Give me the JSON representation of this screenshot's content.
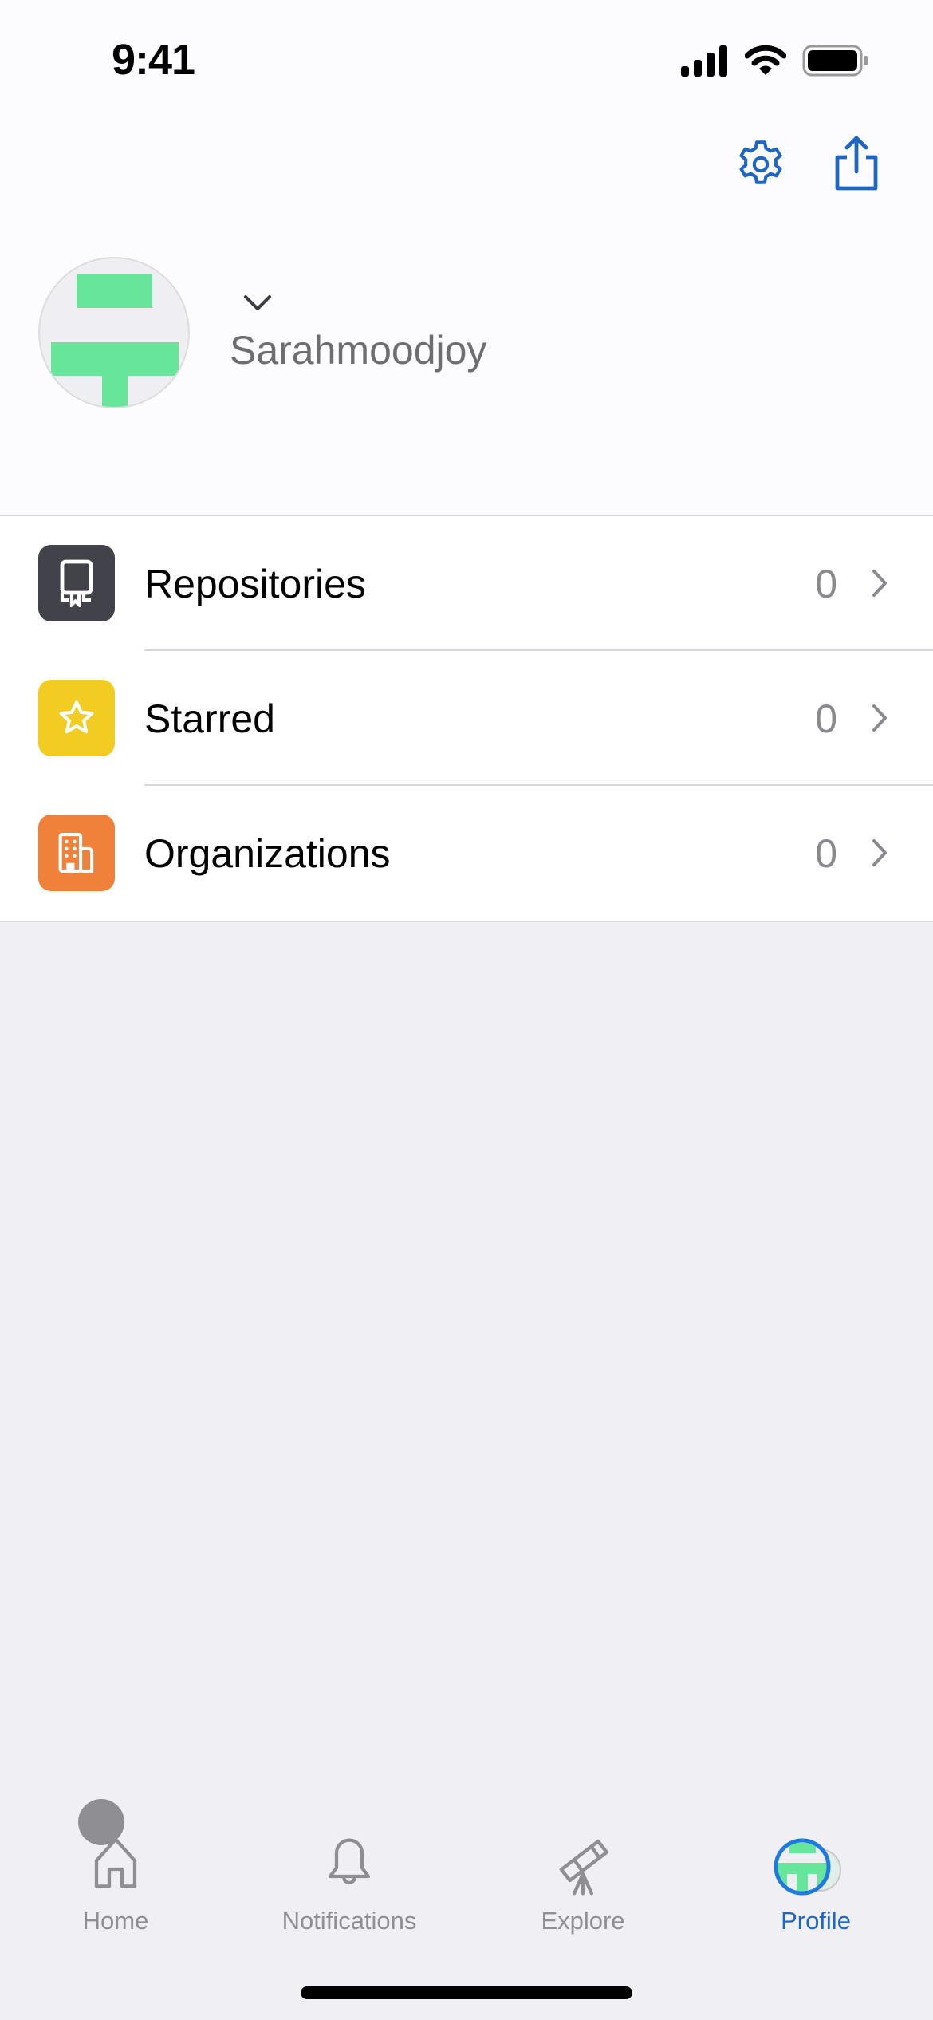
{
  "status_bar": {
    "time": "9:41",
    "icons": [
      "cellular-signal-icon",
      "wifi-icon",
      "battery-icon"
    ]
  },
  "toolbar": {
    "settings_icon": "gear-icon",
    "share_icon": "share-icon"
  },
  "profile": {
    "username": "Sarahmoodjoy",
    "account_switcher_icon": "chevron-down-icon",
    "avatar_color": "#67e59b"
  },
  "menu": {
    "items": [
      {
        "label": "Repositories",
        "count": "0",
        "icon": "repo-icon",
        "color": "#42424a"
      },
      {
        "label": "Starred",
        "count": "0",
        "icon": "star-icon",
        "color": "#f2cb23"
      },
      {
        "label": "Organizations",
        "count": "0",
        "icon": "organization-icon",
        "color": "#f0813b"
      }
    ]
  },
  "tabbar": {
    "tabs": [
      {
        "label": "Home",
        "icon": "home-icon",
        "active": false
      },
      {
        "label": "Notifications",
        "icon": "bell-icon",
        "active": false
      },
      {
        "label": "Explore",
        "icon": "telescope-icon",
        "active": false
      },
      {
        "label": "Profile",
        "icon": "avatar-icon",
        "active": true
      }
    ],
    "accent": "#1f66c1"
  }
}
